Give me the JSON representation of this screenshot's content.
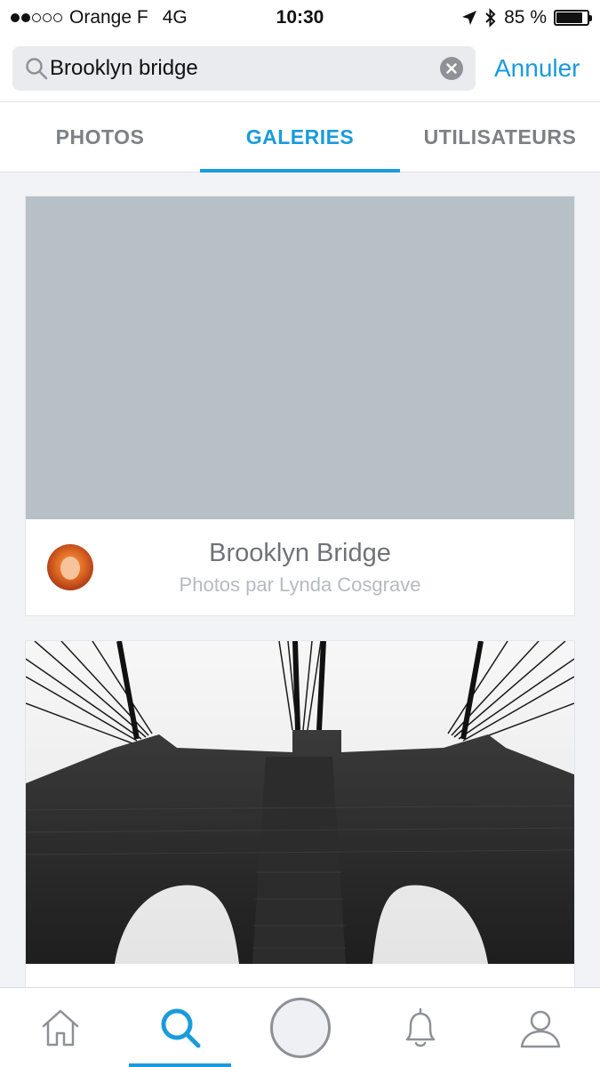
{
  "status_bar": {
    "carrier": "Orange F",
    "network": "4G",
    "time": "10:30",
    "battery": "85 %",
    "battery_level": 0.85
  },
  "search": {
    "query": "Brooklyn bridge",
    "cancel_label": "Annuler"
  },
  "tabs": [
    {
      "label": "PHOTOS",
      "active": false
    },
    {
      "label": "GALERIES",
      "active": true
    },
    {
      "label": "UTILISATEURS",
      "active": false
    }
  ],
  "galleries": [
    {
      "title": "Brooklyn Bridge",
      "subtitle": "Photos par Lynda Cosgrave"
    }
  ],
  "bottom_nav": [
    {
      "icon": "home-icon"
    },
    {
      "icon": "search-icon",
      "active": true
    },
    {
      "icon": "capture-button"
    },
    {
      "icon": "bell-icon"
    },
    {
      "icon": "profile-icon"
    }
  ],
  "colors": {
    "accent": "#1a9bdc",
    "placeholder": "#b8c0c7"
  }
}
